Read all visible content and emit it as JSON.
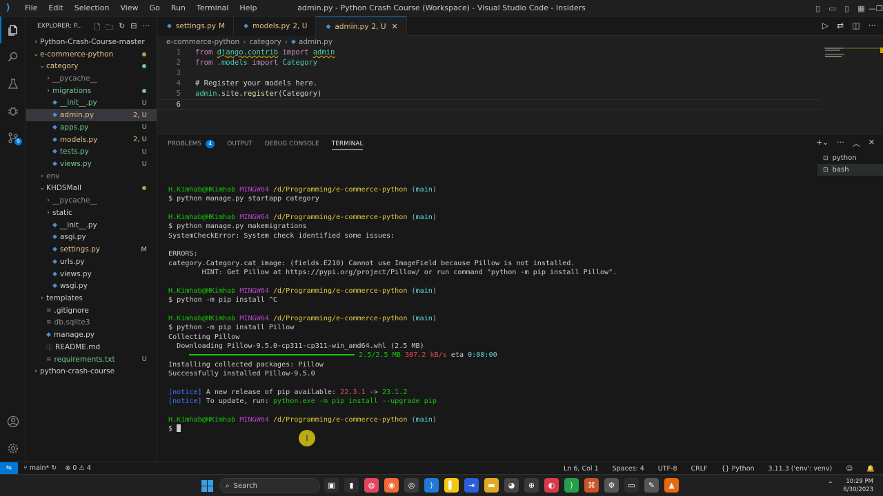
{
  "titlebar": {
    "menu": [
      "File",
      "Edit",
      "Selection",
      "View",
      "Go",
      "Run",
      "Terminal",
      "Help"
    ],
    "title": "admin.py - Python Crash Course (Workspace) - Visual Studio Code - Insiders"
  },
  "activity": {
    "scm_badge": "9"
  },
  "sidebar": {
    "header": "EXPLORER: P...",
    "tree": [
      {
        "label": "Python-Crash-Course-master",
        "depth": 0,
        "kind": "folder-closed",
        "status": ""
      },
      {
        "label": "e-commerce-python",
        "depth": 0,
        "kind": "folder-open",
        "status": "",
        "color": "orange",
        "dot": "#c09553"
      },
      {
        "label": "category",
        "depth": 1,
        "kind": "folder-open",
        "status": "",
        "color": "orange",
        "dot": "#73c991"
      },
      {
        "label": "__pycache__",
        "depth": 2,
        "kind": "folder-closed",
        "status": "",
        "color": "dim"
      },
      {
        "label": "migrations",
        "depth": 2,
        "kind": "folder-closed",
        "status": "",
        "color": "green",
        "dot": "#73c991"
      },
      {
        "label": "__init__.py",
        "depth": 2,
        "kind": "py",
        "status": "U",
        "color": "green"
      },
      {
        "label": "admin.py",
        "depth": 2,
        "kind": "py",
        "status": "2, U",
        "color": "orange",
        "selected": true
      },
      {
        "label": "apps.py",
        "depth": 2,
        "kind": "py",
        "status": "U",
        "color": "green"
      },
      {
        "label": "models.py",
        "depth": 2,
        "kind": "py",
        "status": "2, U",
        "color": "orange"
      },
      {
        "label": "tests.py",
        "depth": 2,
        "kind": "py",
        "status": "U",
        "color": "green"
      },
      {
        "label": "views.py",
        "depth": 2,
        "kind": "py",
        "status": "U",
        "color": "green"
      },
      {
        "label": "env",
        "depth": 1,
        "kind": "folder-closed",
        "status": "",
        "color": "dim"
      },
      {
        "label": "KHDSMall",
        "depth": 1,
        "kind": "folder-open",
        "status": "",
        "dot": "#c09553"
      },
      {
        "label": "__pycache__",
        "depth": 2,
        "kind": "folder-closed",
        "status": "",
        "color": "dim"
      },
      {
        "label": "static",
        "depth": 2,
        "kind": "folder-closed",
        "status": ""
      },
      {
        "label": "__init__.py",
        "depth": 2,
        "kind": "py",
        "status": ""
      },
      {
        "label": "asgi.py",
        "depth": 2,
        "kind": "py",
        "status": ""
      },
      {
        "label": "settings.py",
        "depth": 2,
        "kind": "py",
        "status": "M",
        "color": "mod"
      },
      {
        "label": "urls.py",
        "depth": 2,
        "kind": "py",
        "status": ""
      },
      {
        "label": "views.py",
        "depth": 2,
        "kind": "py",
        "status": ""
      },
      {
        "label": "wsgi.py",
        "depth": 2,
        "kind": "py",
        "status": ""
      },
      {
        "label": "templates",
        "depth": 1,
        "kind": "folder-closed",
        "status": ""
      },
      {
        "label": ".gitignore",
        "depth": 1,
        "kind": "file",
        "status": ""
      },
      {
        "label": "db.sqlite3",
        "depth": 1,
        "kind": "file",
        "status": "",
        "color": "dim"
      },
      {
        "label": "manage.py",
        "depth": 1,
        "kind": "py",
        "status": ""
      },
      {
        "label": "README.md",
        "depth": 1,
        "kind": "info",
        "status": ""
      },
      {
        "label": "requirements.txt",
        "depth": 1,
        "kind": "file",
        "status": "U",
        "color": "green"
      },
      {
        "label": "python-crash-course",
        "depth": 0,
        "kind": "folder-closed",
        "status": ""
      }
    ]
  },
  "tabs": [
    {
      "label": "settings.py",
      "suffix": "M",
      "active": false
    },
    {
      "label": "models.py",
      "suffix": "2, U",
      "active": false
    },
    {
      "label": "admin.py",
      "suffix": "2, U",
      "active": true
    }
  ],
  "breadcrumb": [
    "e-commerce-python",
    "category",
    "admin.py"
  ],
  "editor": {
    "lines": [
      {
        "n": "1"
      },
      {
        "n": "2"
      },
      {
        "n": "3"
      },
      {
        "n": "4"
      },
      {
        "n": "5"
      },
      {
        "n": "6"
      }
    ],
    "code": {
      "l1_from": "from",
      "l1_mod": "django.contrib",
      "l1_import": "import",
      "l1_name": "admin",
      "l2_from": "from",
      "l2_mod": ".models",
      "l2_import": "import",
      "l2_name": "Category",
      "l4_comment": "# Register your models here.",
      "l5_a": "admin",
      "l5_b": ".site.",
      "l5_c": "register",
      "l5_d": "(Category)"
    }
  },
  "panel": {
    "tabs": [
      "PROBLEMS",
      "OUTPUT",
      "DEBUG CONSOLE",
      "TERMINAL"
    ],
    "problems_count": "4",
    "terminals": [
      "python",
      "bash"
    ]
  },
  "terminal": {
    "user": "H.Kimhab@HKimhab",
    "shell": "MINGW64",
    "path": "/d/Programming/e-commerce-python",
    "branch": "(main)",
    "cmd1": "$ python manage.py startapp category",
    "cmd2": "$ python manage.py makemigrations",
    "err1": "SystemCheckError: System check identified some issues:",
    "err_head": "ERRORS:",
    "err2": "category.Category.cat_image: (fields.E210) Cannot use ImageField because Pillow is not installed.",
    "err3": "        HINT: Get Pillow at https://pypi.org/project/Pillow/ or run command \"python -m pip install Pillow\".",
    "cmd3": "$ python -m pip install ^C",
    "cmd4": "$ python -m pip install Pillow",
    "collect": "Collecting Pillow",
    "download": "  Downloading Pillow-9.5.0-cp311-cp311-win_amd64.whl (2.5 MB)",
    "progress_size": "2.5/2.5 MB",
    "progress_rate": "307.2 kB/s",
    "progress_eta_label": "eta",
    "progress_eta": "0:00:00",
    "progress_fraction": 1.0,
    "install1": "Installing collected packages: Pillow",
    "install2": "Successfully installed Pillow-9.5.0",
    "notice_tag": "[notice]",
    "notice1_a": " A new release of pip available: ",
    "notice1_old": "22.3.1",
    "notice1_arrow": " -> ",
    "notice1_new": "23.1.2",
    "notice2_a": " To update, run: ",
    "notice2_cmd": "python.exe -m pip install --upgrade pip",
    "prompt": "$ "
  },
  "statusbar": {
    "branch": "main*",
    "errors": "0",
    "warnings": "4",
    "position": "Ln 6, Col 1",
    "spaces": "Spaces: 4",
    "encoding": "UTF-8",
    "eol": "CRLF",
    "language": "Python",
    "interpreter": "3.11.3 ('env': venv)"
  },
  "taskbar": {
    "search": "Search",
    "time": "10:29 PM",
    "date": "6/30/2023"
  },
  "colors": {
    "accent": "#0078d4",
    "untracked": "#73c991",
    "modified": "#e2c08d"
  }
}
